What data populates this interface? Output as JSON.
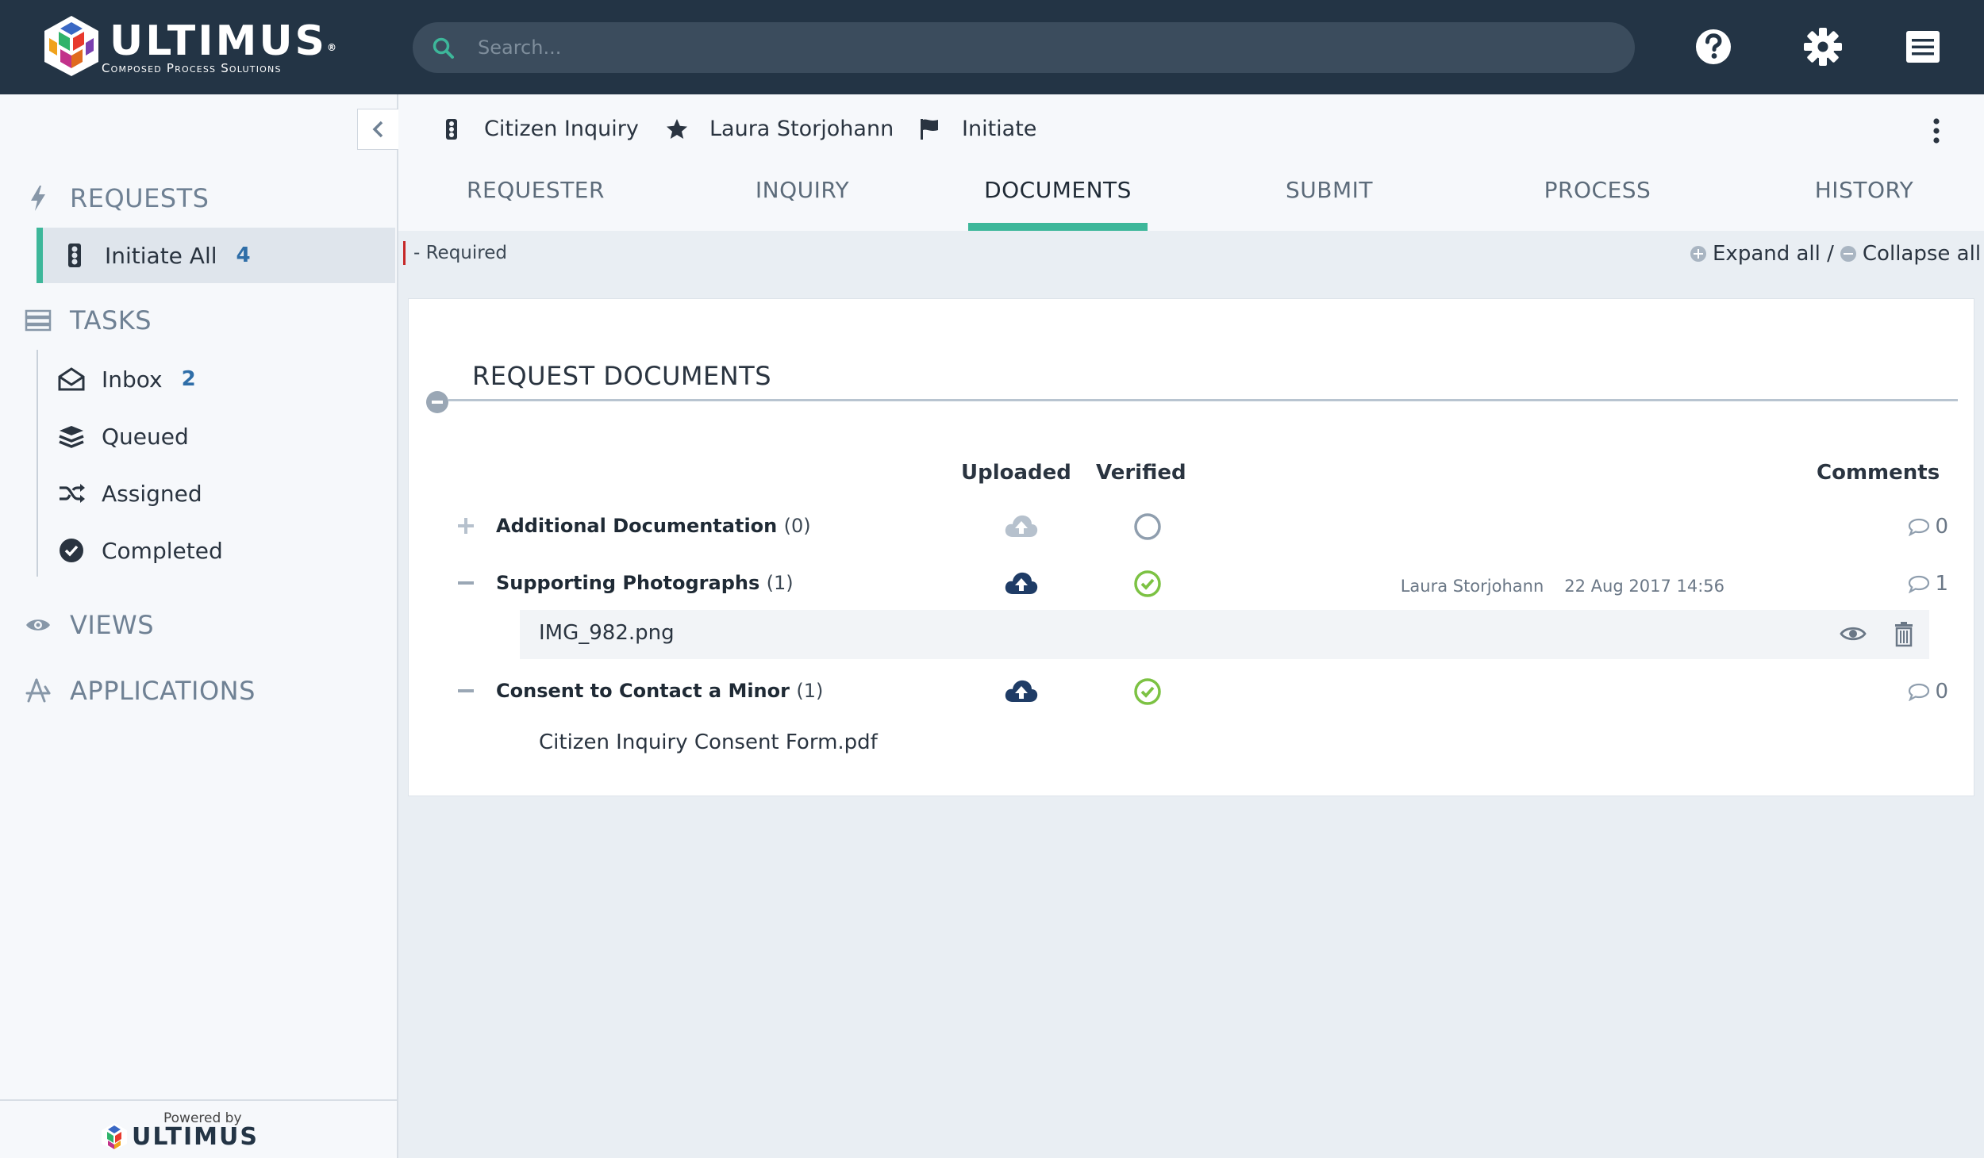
{
  "app": {
    "brand": "ULTIMUS",
    "tagline": "Composed Process Solutions",
    "search_placeholder": "Search...",
    "footer_powered": "Powered by",
    "footer_brand": "ULTIMUS"
  },
  "sidebar": {
    "requests": {
      "label": "REQUESTS",
      "items": [
        {
          "label": "Initiate All",
          "count": "4",
          "icon": "traffic-light-icon"
        }
      ]
    },
    "tasks": {
      "label": "TASKS",
      "items": [
        {
          "label": "Inbox",
          "count": "2",
          "icon": "inbox-icon"
        },
        {
          "label": "Queued",
          "icon": "layers-icon"
        },
        {
          "label": "Assigned",
          "icon": "shuffle-icon"
        },
        {
          "label": "Completed",
          "icon": "check-circle-icon"
        }
      ]
    },
    "views": {
      "label": "VIEWS"
    },
    "applications": {
      "label": "APPLICATIONS"
    }
  },
  "header": {
    "crumbs": [
      {
        "label": "Citizen Inquiry",
        "icon": "traffic-light-icon"
      },
      {
        "label": "Laura Storjohann",
        "icon": "star-icon"
      },
      {
        "label": "Initiate",
        "icon": "flag-icon"
      }
    ],
    "tabs": [
      {
        "label": "REQUESTER"
      },
      {
        "label": "INQUIRY"
      },
      {
        "label": "DOCUMENTS",
        "active": true
      },
      {
        "label": "SUBMIT"
      },
      {
        "label": "PROCESS"
      },
      {
        "label": "HISTORY"
      }
    ]
  },
  "form": {
    "required_note": "- Required",
    "expand_all": "Expand all /",
    "collapse_all": "Collapse all"
  },
  "documents": {
    "title": "REQUEST DOCUMENTS",
    "columns": {
      "uploaded": "Uploaded",
      "verified": "Verified",
      "comments": "Comments"
    },
    "groups": [
      {
        "name": "Additional Documentation",
        "count": "(0)",
        "expanded": false,
        "uploaded": false,
        "verified": false,
        "comments": "0"
      },
      {
        "name": "Supporting Photographs",
        "count": "(1)",
        "expanded": true,
        "uploaded": true,
        "verified": true,
        "author": "Laura Storjohann",
        "date": "22 Aug 2017 14:56",
        "comments": "1",
        "files": [
          {
            "name": "IMG_982.png"
          }
        ]
      },
      {
        "name": "Consent to Contact a Minor",
        "count": "(1)",
        "expanded": true,
        "uploaded": true,
        "verified": true,
        "comments": "0",
        "files": [
          {
            "name": "Citizen Inquiry Consent Form.pdf"
          }
        ]
      }
    ]
  },
  "colors": {
    "topbar": "#233445",
    "accent": "#3db79a",
    "verified": "#7cc243",
    "upload": "#1f3c66"
  }
}
